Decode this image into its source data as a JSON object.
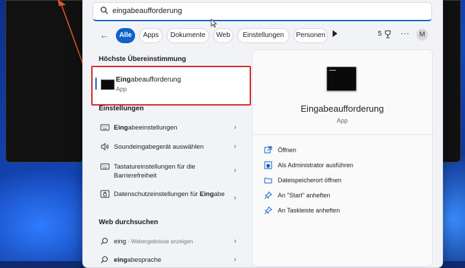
{
  "search": {
    "value": "eingabeaufforderung"
  },
  "filters": {
    "back_label": "←",
    "chips": [
      "Alle",
      "Apps",
      "Dokumente",
      "Web",
      "Einstellungen",
      "Personen"
    ],
    "count": "5",
    "more_label": "···",
    "avatar_initial": "M"
  },
  "best_match": {
    "section_title": "Höchste Übereinstimmung",
    "name_bold": "Eing",
    "name_rest": "abeaufforderung",
    "type": "App"
  },
  "settings": {
    "section_title": "Einstellungen",
    "items": [
      {
        "bold": "Eing",
        "rest": "abeeinstellungen",
        "icon": "keyboard-icon"
      },
      {
        "bold": "",
        "rest": "Soundeingabegerät auswählen",
        "icon": "speaker-icon"
      },
      {
        "bold": "",
        "rest": "Tastatureinstellungen für die Barrierefreiheit",
        "icon": "keyboard-icon"
      },
      {
        "pre": "Datenschutzeinstellungen für ",
        "bold": "Eing",
        "rest": "abe",
        "icon": "privacy-icon"
      }
    ]
  },
  "web": {
    "section_title": "Web durchsuchen",
    "items": [
      {
        "text": "eing",
        "sub": " - Webergebnisse anzeigen",
        "icon": "search-icon"
      },
      {
        "text": "eingabesprache",
        "sub": "",
        "icon": "search-icon"
      }
    ]
  },
  "preview": {
    "title": "Eingabeaufforderung",
    "type": "App",
    "actions": [
      {
        "label": "Öffnen",
        "icon": "open-icon"
      },
      {
        "label": "Als Administrator ausführen",
        "icon": "admin-icon"
      },
      {
        "label": "Dateispeicherort öffnen",
        "icon": "folder-icon"
      },
      {
        "label": "An \"Start\" anheften",
        "icon": "pin-icon"
      },
      {
        "label": "An Taskleiste anheften",
        "icon": "pin-icon"
      }
    ]
  },
  "colors": {
    "accent": "#0f62c9",
    "highlight_border": "#d32a2a",
    "annotation_arrow": "#e0562b"
  }
}
